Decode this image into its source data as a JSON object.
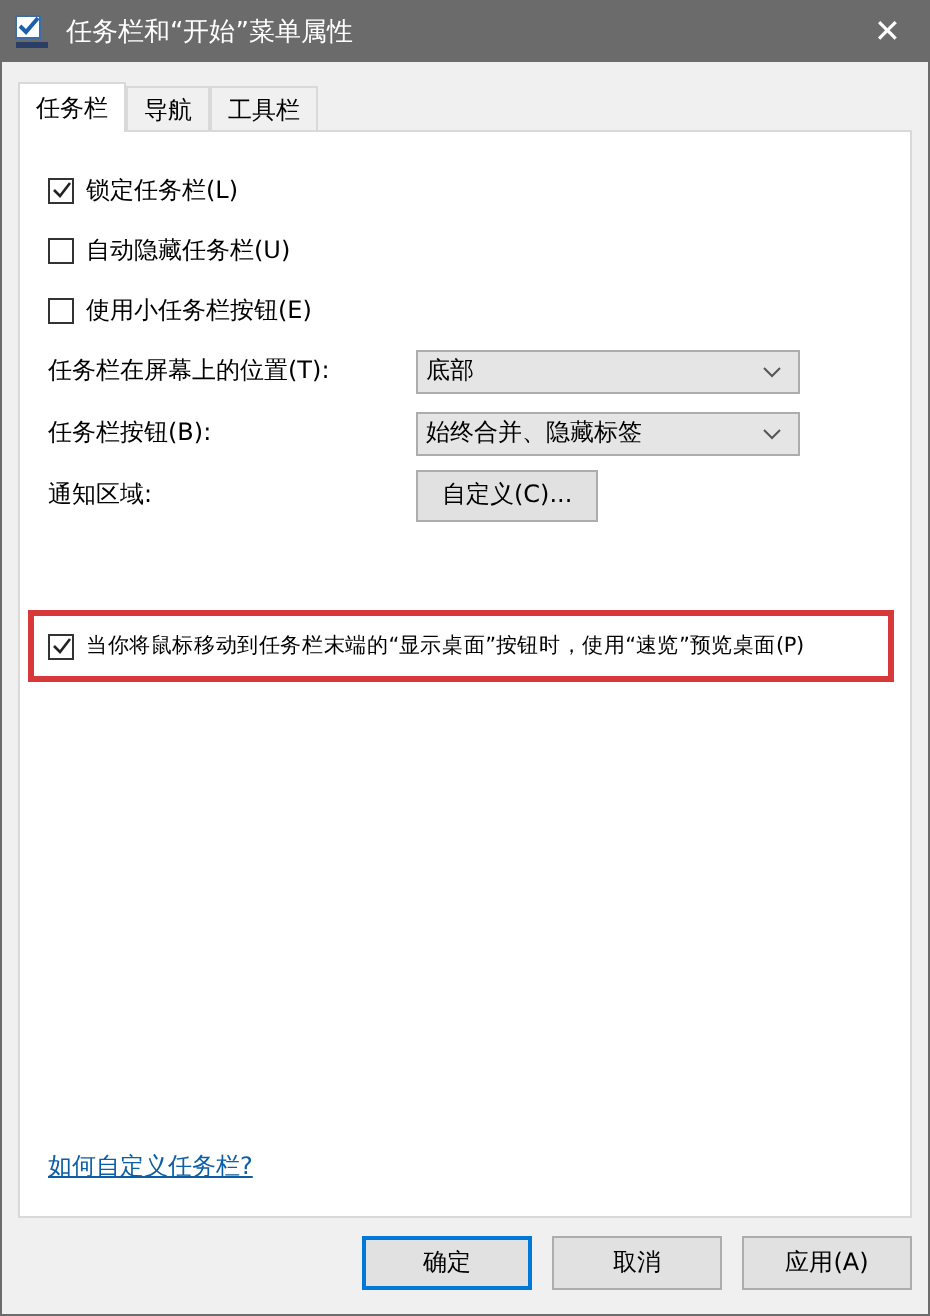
{
  "window": {
    "title": "任务栏和“开始”菜单属性",
    "close": "✕"
  },
  "tabs": [
    {
      "label": "任务栏",
      "selected": true
    },
    {
      "label": "导航",
      "selected": false
    },
    {
      "label": "工具栏",
      "selected": false
    }
  ],
  "options": [
    {
      "label": "锁定任务栏(L)",
      "checked": true
    },
    {
      "label": "自动隐藏任务栏(U)",
      "checked": false
    },
    {
      "label": "使用小任务栏按钮(E)",
      "checked": false
    }
  ],
  "settings": [
    {
      "kind": "dropdown",
      "label": "任务栏在屏幕上的位置(T):",
      "value": "底部"
    },
    {
      "kind": "dropdown",
      "label": "任务栏按钮(B):",
      "value": "始终合并、隐藏标签"
    },
    {
      "kind": "button",
      "label": "通知区域:",
      "value": "自定义(C)..."
    }
  ],
  "peek": {
    "label": "当你将鼠标移动到任务栏末端的“显示桌面”按钮时，使用“速览”预览桌面(P)",
    "checked": true,
    "highlighted": true
  },
  "help_link": "如何自定义任务栏?",
  "buttons": [
    {
      "label": "确定",
      "default": true
    },
    {
      "label": "取消",
      "default": false
    },
    {
      "label": "应用(A)",
      "default": false
    }
  ]
}
